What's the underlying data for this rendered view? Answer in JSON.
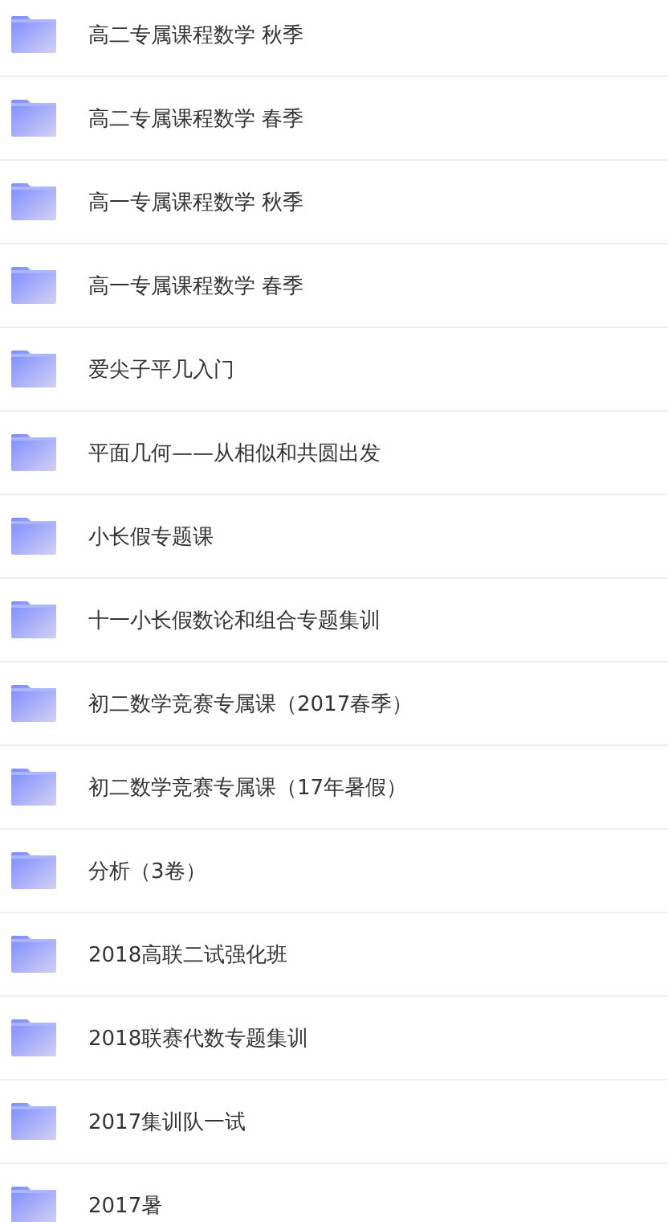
{
  "folders": [
    {
      "name": "高二专属课程数学 秋季"
    },
    {
      "name": "高二专属课程数学 春季"
    },
    {
      "name": "高一专属课程数学 秋季"
    },
    {
      "name": "高一专属课程数学 春季"
    },
    {
      "name": "爱尖子平几入门"
    },
    {
      "name": "平面几何——从相似和共圆出发"
    },
    {
      "name": "小长假专题课"
    },
    {
      "name": "十一小长假数论和组合专题集训"
    },
    {
      "name": "初二数学竞赛专属课（2017春季）"
    },
    {
      "name": "初二数学竞赛专属课（17年暑假）"
    },
    {
      "name": "分析（3卷）"
    },
    {
      "name": "2018高联二试强化班"
    },
    {
      "name": "2018联赛代数专题集训"
    },
    {
      "name": "2017集训队一试"
    },
    {
      "name": "2017暑"
    }
  ]
}
